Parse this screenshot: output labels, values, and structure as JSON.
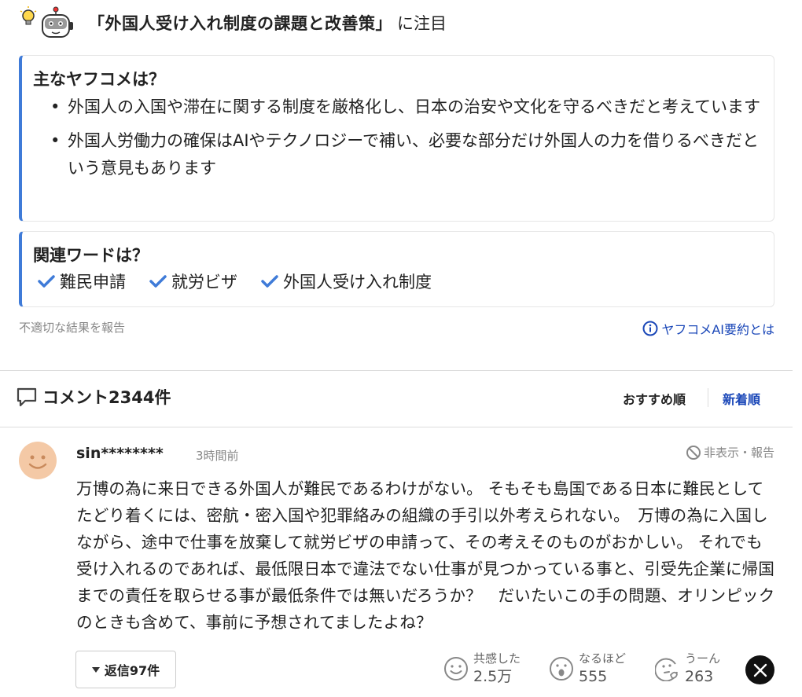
{
  "header": {
    "title": "「外国人受け入れ制度の課題と改善策」",
    "suffix": "に注目"
  },
  "summary": {
    "title": "主なヤフコメは？",
    "items": [
      "外国人の入国や滞在に関する制度を厳格化し、日本の治安や文化を守るべきだと考えています",
      "外国人労働力の確保はAIやテクノロジーで補い、必要な部分だけ外国人の力を借りるべきだという意見もあります"
    ]
  },
  "keywords": {
    "title": "関連ワードは？",
    "items": [
      "難民申請",
      "就労ビザ",
      "外国人受け入れ制度"
    ]
  },
  "links": {
    "report": "不適切な結果を報告",
    "about": "ヤフコメAI要約とは"
  },
  "comments": {
    "title": "コメント2344件",
    "sort_recommended": "おすすめ順",
    "sort_newest": "新着順"
  },
  "comment": {
    "user": "sin********",
    "time": "3時間前",
    "hide_report": "非表示・報告",
    "body": "万博の為に来日できる外国人が難民であるわけがない。 そもそも島国である日本に難民としてたどり着くには、密航・密入国や犯罪絡みの組織の手引以外考えられない。　万博の為に入国しながら、途中で仕事を放棄して就労ビザの申請って、その考えそのものがおかしい。 それでも受け入れるのであれば、最低限日本で違法でない仕事が見つかっている事と、引受先企業に帰国までの責任を取らせる事が最低条件では無いだろうか？　だいたいこの手の問題、オリンピックのときも含めて、事前に予想されてましたよね？",
    "reply_label": "返信97件",
    "reactions": [
      {
        "label": "共感した",
        "count": "2.5万",
        "icon": "smile-face-icon"
      },
      {
        "label": "なるほど",
        "count": "555",
        "icon": "surprised-face-icon"
      },
      {
        "label": "うーん",
        "count": "263",
        "icon": "thinking-face-icon"
      }
    ]
  },
  "colors": {
    "accent": "#3f7bd8",
    "link": "#1a47b8",
    "avatar": "#f4c9a6"
  }
}
